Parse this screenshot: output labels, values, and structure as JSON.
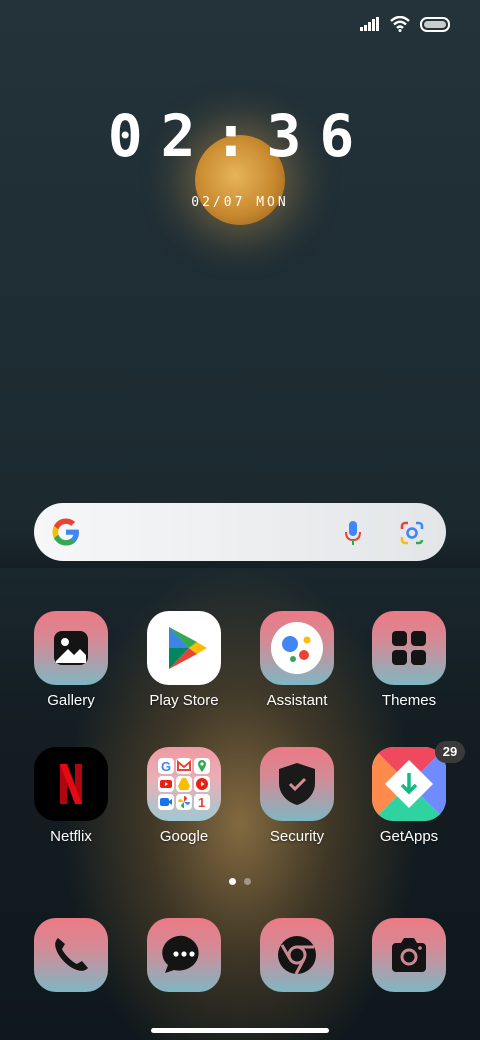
{
  "status": {
    "signal_icon": "signal-icon",
    "wifi_icon": "wifi-icon",
    "battery_icon": "battery-icon"
  },
  "clock": {
    "time": "02:36",
    "date": "02/07 MON"
  },
  "search": {
    "google_icon": "google-g-icon",
    "mic_icon": "microphone-icon",
    "lens_icon": "google-lens-icon"
  },
  "apps": {
    "gallery": "Gallery",
    "play_store": "Play Store",
    "assistant": "Assistant",
    "themes": "Themes",
    "netflix": "Netflix",
    "google": "Google",
    "security": "Security",
    "getapps": "GetApps",
    "getapps_badge": "29"
  },
  "dock": [
    "phone-icon",
    "messages-icon",
    "chrome-icon",
    "camera-icon"
  ],
  "pager": {
    "pages": 2,
    "current": 1
  },
  "colors": {
    "tile_top": "#ec7a86",
    "tile_bottom": "#7fb6c3",
    "moon": "#e7b45a",
    "sky": "#24333a"
  }
}
